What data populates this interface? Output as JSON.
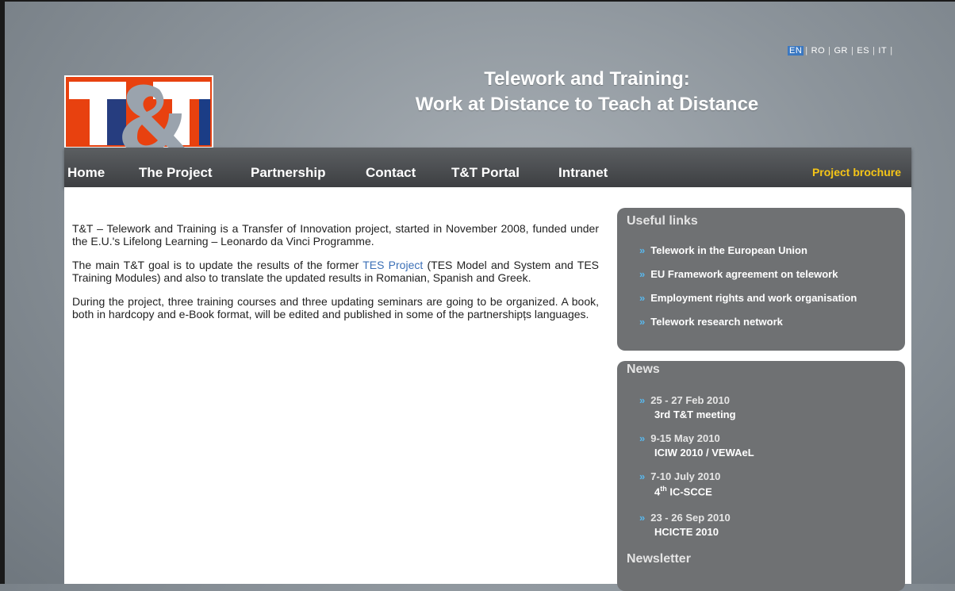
{
  "languages": [
    {
      "code": "EN",
      "active": true
    },
    {
      "code": "RO",
      "active": false
    },
    {
      "code": "GR",
      "active": false
    },
    {
      "code": "ES",
      "active": false
    },
    {
      "code": "IT",
      "active": false
    }
  ],
  "lang_separator": "|",
  "logo": {
    "text": "T&T"
  },
  "header": {
    "title_line1": "Telework and Training:",
    "title_line2": "Work at Distance to Teach at Distance"
  },
  "nav": {
    "items": [
      "Home",
      "The Project",
      "Partnership",
      "Contact",
      "T&T Portal",
      "Intranet"
    ],
    "brochure": "Project brochure"
  },
  "main": {
    "para1": "T&T – Telework and Training is a Transfer of Innovation project, started in November 2008, funded under the E.U.'s Lifelong Learning – Leonardo da Vinci Programme.",
    "para2_before": "The main T&T goal is to update the results of the former ",
    "para2_link": "TES Project",
    "para2_after": " (TES Model and System and TES Training Modules) and also to translate the updated results in Romanian, Spanish and Greek.",
    "para3": "During the project, three training courses and three updating seminars are going to be organized. A book, both in hardcopy and e-Book format, will be edited and published in some of the partnershipțs languages."
  },
  "useful_links": {
    "title": "Useful links",
    "arrow": "»",
    "items": [
      "Telework in the European Union",
      "EU Framework agreement on telework",
      "Employment rights and work organisation",
      "Telework research network"
    ]
  },
  "news": {
    "title": "News",
    "items": [
      {
        "date": "25 - 27 Feb 2010",
        "title": "3rd T&T meeting"
      },
      {
        "date": "9-15 May 2010",
        "title": "ICIW 2010 / VEWAeL"
      },
      {
        "date": "7-10 July 2010",
        "title_num": "4",
        "title_sup": "th",
        "title_rest": " IC-SCCE"
      },
      {
        "date": "23 - 26 Sep 2010",
        "title": "HCICTE 2010"
      }
    ]
  },
  "newsletter": {
    "title": "Newsletter"
  },
  "colors": {
    "accent_link": "#3b6fb6",
    "brochure": "#f5c517",
    "arrow": "#59b7ec",
    "logo_red": "#e8410f",
    "logo_blue": "#1b3d86"
  }
}
